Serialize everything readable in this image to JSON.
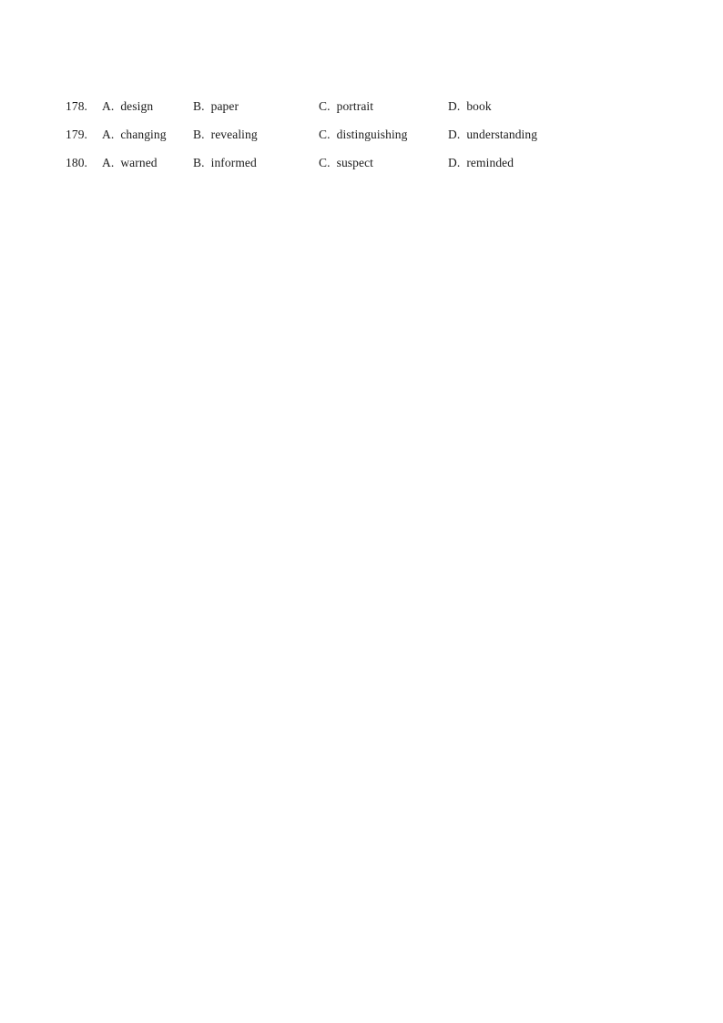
{
  "document": {
    "background_color": "#ffffff",
    "text_color": "#1a1a1a",
    "questions": [
      {
        "number": "178.",
        "options": [
          {
            "letter": "A.",
            "text": "design"
          },
          {
            "letter": "B.",
            "text": "paper"
          },
          {
            "letter": "C.",
            "text": "portrait"
          },
          {
            "letter": "D.",
            "text": "book"
          }
        ]
      },
      {
        "number": "179.",
        "options": [
          {
            "letter": "A.",
            "text": "changing"
          },
          {
            "letter": "B.",
            "text": "revealing"
          },
          {
            "letter": "C.",
            "text": "distinguishing"
          },
          {
            "letter": "D.",
            "text": "understanding"
          }
        ]
      },
      {
        "number": "180.",
        "options": [
          {
            "letter": "A.",
            "text": "warned"
          },
          {
            "letter": "B.",
            "text": "informed"
          },
          {
            "letter": "C.",
            "text": "suspect"
          },
          {
            "letter": "D.",
            "text": "reminded"
          }
        ]
      }
    ]
  }
}
